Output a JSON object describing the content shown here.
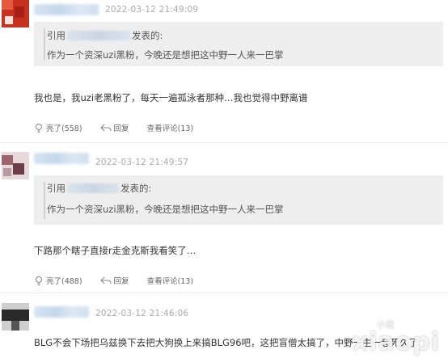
{
  "comments": [
    {
      "time": "2022-03-12 21:49:09",
      "quote_prefix": "引用",
      "quote_suffix": "发表的:",
      "quote_text": "作为一个资深uzi黑粉，今晚还是想把这中野一人来一巴掌",
      "text": "我也是，我uzi老黑粉了，每天一遍孤泳者那种…我也觉得中野离谱",
      "like_label": "亮了(558)",
      "reply_label": "回复",
      "view_replies_label": "查看评论(13)"
    },
    {
      "time": "2022-03-12 21:49:57",
      "quote_prefix": "引用",
      "quote_suffix": "发表的:",
      "quote_text": "作为一个资深uzi黑粉，今晚还是想把这中野一人来一巴掌",
      "text": "下路那个瞎子直接r走金克斯我看笑了…",
      "like_label": "亮了(488)",
      "reply_label": "回复",
      "view_replies_label": "查看评论(13)"
    },
    {
      "time": "2022-03-12 21:46:06",
      "text": "BLG不会下场把乌兹换下去把大狗换上来搞BLG96吧，这把盲僧太搞了，中野一生一起死久了"
    }
  ],
  "watermark": {
    "main": "xiaopi",
    "small": "小皮"
  },
  "colors": {
    "time": "#aaaaaa",
    "quote_bg": "#eeeeee",
    "text": "#333333"
  }
}
